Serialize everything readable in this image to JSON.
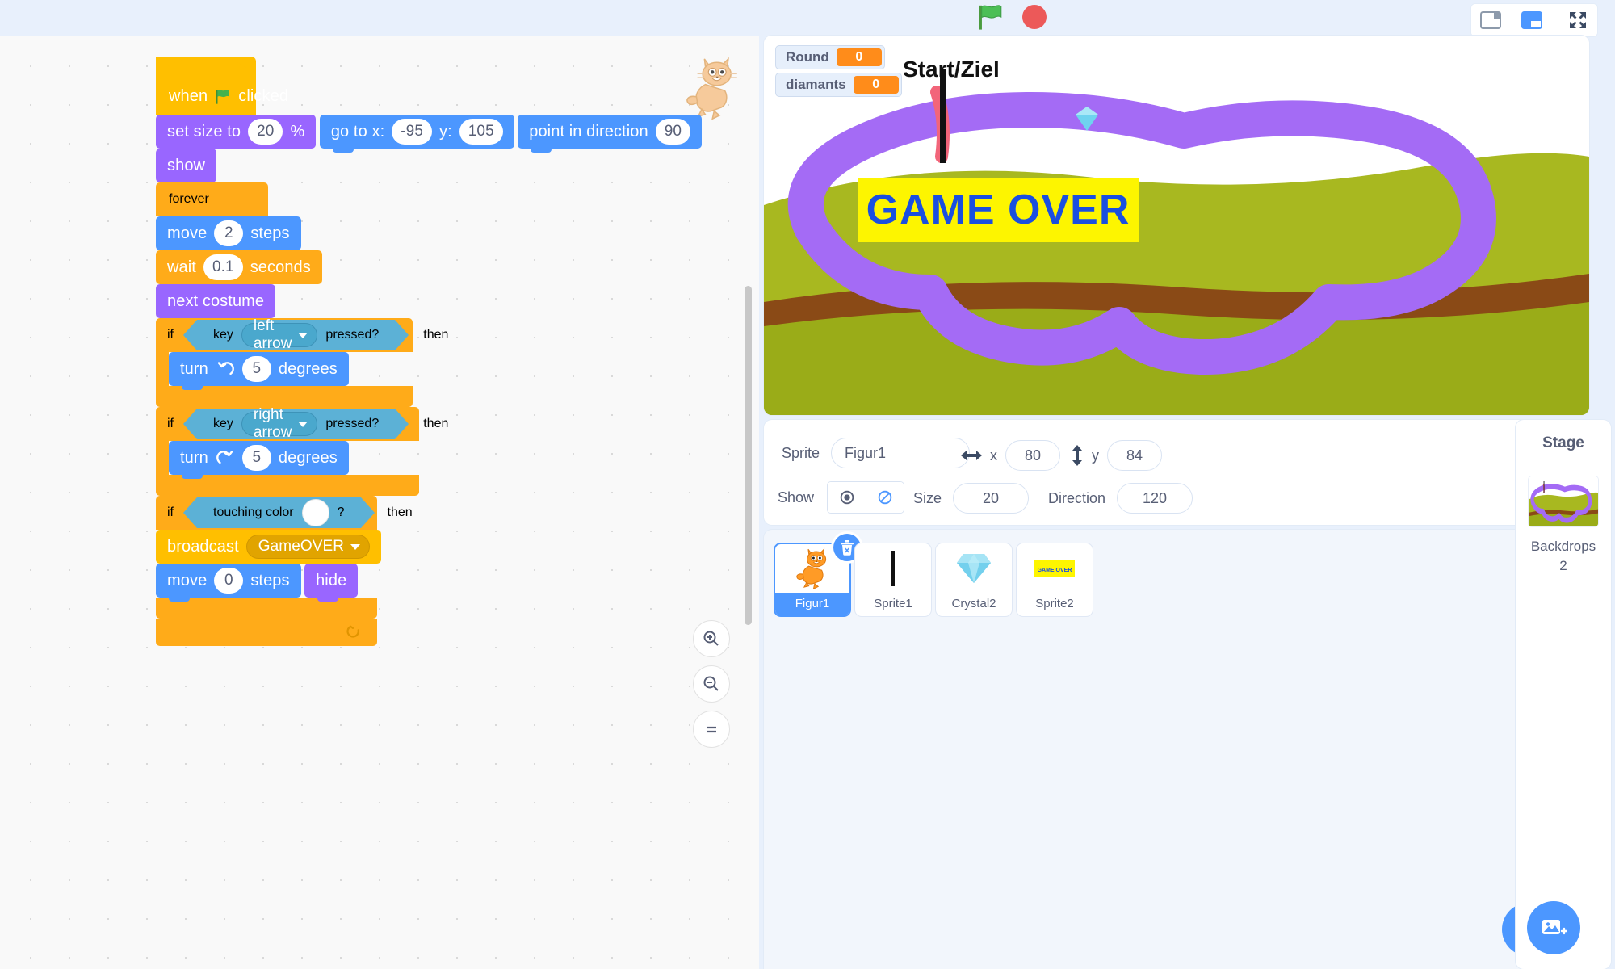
{
  "toolbar": {
    "green_flag_icon": "green-flag-icon",
    "stop_icon": "stop-sign-icon",
    "layout_small_icon": "small-stage-layout-icon",
    "layout_large_icon": "large-stage-layout-icon",
    "layout_fullscreen_icon": "fullscreen-icon"
  },
  "code": {
    "zoom_in_icon": "zoom-in-icon",
    "zoom_out_icon": "zoom-out-icon",
    "zoom_reset_icon": "zoom-reset-icon",
    "watermark_icon": "sprite-watermark-cat-icon",
    "script": {
      "when_flag_clicked": {
        "pre": "when",
        "post": "clicked"
      },
      "set_size": {
        "label": "set size to",
        "value": "20",
        "unit": "%"
      },
      "go_to_xy": {
        "label": "go to x:",
        "x": "-95",
        "ylabel": "y:",
        "y": "105"
      },
      "point_in_direction": {
        "label": "point in direction",
        "value": "90"
      },
      "show": {
        "label": "show"
      },
      "forever": {
        "label": "forever"
      },
      "move_steps": {
        "label": "move",
        "value": "2",
        "unit": "steps"
      },
      "wait_seconds": {
        "label": "wait",
        "value": "0.1",
        "unit": "seconds"
      },
      "next_costume": {
        "label": "next costume"
      },
      "if_left": {
        "if": "if",
        "then": "then",
        "key": "key",
        "option": "left arrow",
        "pressed": "pressed?",
        "turn": "turn",
        "degrees_value": "5",
        "degrees": "degrees",
        "turn_icon": "turn-counterclockwise-icon"
      },
      "if_right": {
        "if": "if",
        "then": "then",
        "key": "key",
        "option": "right arrow",
        "pressed": "pressed?",
        "turn": "turn",
        "degrees_value": "5",
        "degrees": "degrees",
        "turn_icon": "turn-clockwise-icon"
      },
      "if_touching": {
        "if": "if",
        "then": "then",
        "label": "touching color",
        "question": "?",
        "color": "#ffffff",
        "broadcast_label": "broadcast",
        "broadcast_value": "GameOVER",
        "move_label": "move",
        "move_value": "0",
        "move_unit": "steps",
        "hide_label": "hide"
      }
    }
  },
  "stage": {
    "monitors": [
      {
        "label": "Round",
        "value": "0"
      },
      {
        "label": "diamants",
        "value": "0"
      }
    ],
    "start_ziel_label": "Start/Ziel",
    "game_over_text": "GAME OVER",
    "game_over_bg": "#fdf500",
    "game_over_fg": "#1a4fe0",
    "path_color": "#a46bf5",
    "grass_color": "#a8b820",
    "sky_color": "#ffffff"
  },
  "sprite_info": {
    "sprite_label": "Sprite",
    "sprite_name": "Figur1",
    "x_label": "x",
    "x_value": "80",
    "y_label": "y",
    "y_value": "84",
    "show_label": "Show",
    "show_on_icon": "eye-show-icon",
    "show_off_icon": "eye-hide-icon",
    "size_label": "Size",
    "size_value": "20",
    "direction_label": "Direction",
    "direction_value": "120",
    "x_arrow_icon": "horizontal-arrow-icon",
    "y_arrow_icon": "vertical-arrow-icon"
  },
  "sprites": [
    {
      "name": "Figur1",
      "icon": "cat-sprite-icon",
      "selected": true,
      "delete_icon": "delete-trash-icon"
    },
    {
      "name": "Sprite1",
      "icon": "line-sprite-icon",
      "selected": false
    },
    {
      "name": "Crystal2",
      "icon": "crystal-gem-icon",
      "selected": false
    },
    {
      "name": "Sprite2",
      "icon": "game-over-sign-icon",
      "selected": false,
      "thumb_text": "GAME OVER"
    }
  ],
  "add_sprite_icon": "add-sprite-cat-icon",
  "stage_panel": {
    "title": "Stage",
    "backdrops_label": "Backdrops",
    "backdrops_count": "2",
    "add_backdrop_icon": "add-backdrop-image-icon"
  }
}
